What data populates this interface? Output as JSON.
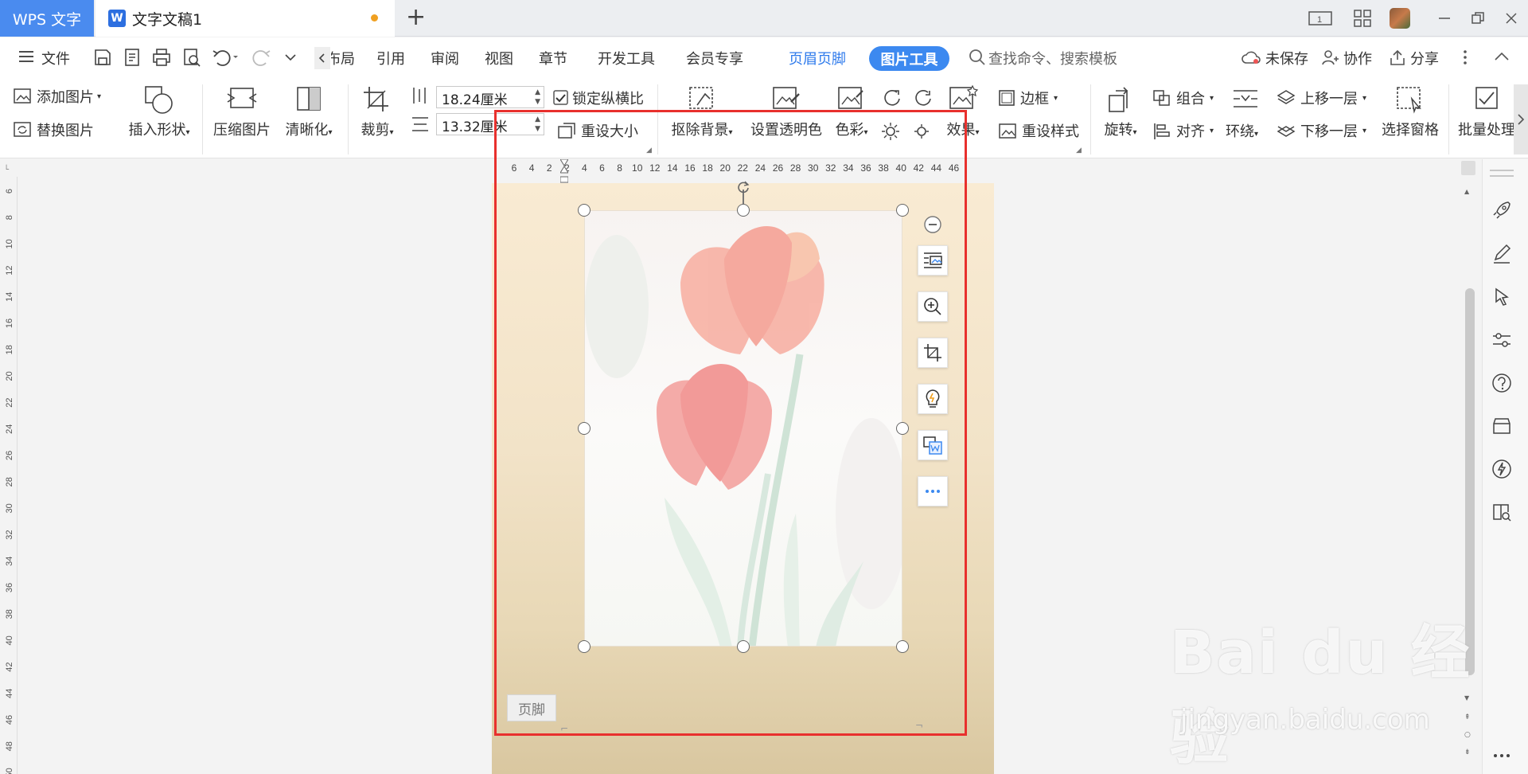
{
  "titlebar": {
    "app_tab": "WPS 文字",
    "doc_tab": "文字文稿1",
    "doc_icon": "W"
  },
  "menu": {
    "file": "文件",
    "items": [
      "布局",
      "引用",
      "审阅",
      "视图",
      "章节",
      "开发工具",
      "会员专享",
      "页眉页脚"
    ],
    "active": "图片工具",
    "search_placeholder": "查找命令、搜索模板",
    "unsaved": "未保存",
    "collab": "协作",
    "share": "分享"
  },
  "ribbon": {
    "add_picture": "添加图片",
    "replace_picture": "替换图片",
    "insert_shape": "插入形状",
    "compress": "压缩图片",
    "sharpen": "清晰化",
    "crop": "裁剪",
    "height_value": "18.24厘米",
    "width_value": "13.32厘米",
    "lock_ratio": "锁定纵横比",
    "reset_size": "重设大小",
    "remove_bg": "抠除背景",
    "set_transparent": "设置透明色",
    "color": "色彩",
    "effects": "效果",
    "border": "边框",
    "reset_style": "重设样式",
    "rotate": "旋转",
    "group": "组合",
    "align": "对齐",
    "wrap": "环绕",
    "bring_forward": "上移一层",
    "send_backward": "下移一层",
    "selection_pane": "选择窗格",
    "batch": "批量处理"
  },
  "ruler": {
    "h_ticks": [
      "6",
      "4",
      "2",
      "2",
      "4",
      "6",
      "8",
      "10",
      "12",
      "14",
      "16",
      "18",
      "20",
      "22",
      "24",
      "26",
      "28",
      "30",
      "32",
      "34",
      "36",
      "38",
      "40",
      "42",
      "44",
      "46"
    ],
    "v_ticks": [
      "6",
      "8",
      "10",
      "12",
      "14",
      "16",
      "18",
      "20",
      "22",
      "24",
      "26",
      "28",
      "30",
      "32",
      "34",
      "36",
      "38",
      "40",
      "42",
      "44",
      "46",
      "48",
      "50"
    ]
  },
  "document": {
    "footer_label": "页脚"
  },
  "watermark": {
    "brand": "Bai du 经验",
    "url": "jingyan.baidu.com"
  },
  "colors": {
    "accent": "#3c89f0",
    "app_tab": "#4a8bef",
    "highlight_box": "#e8302d"
  }
}
